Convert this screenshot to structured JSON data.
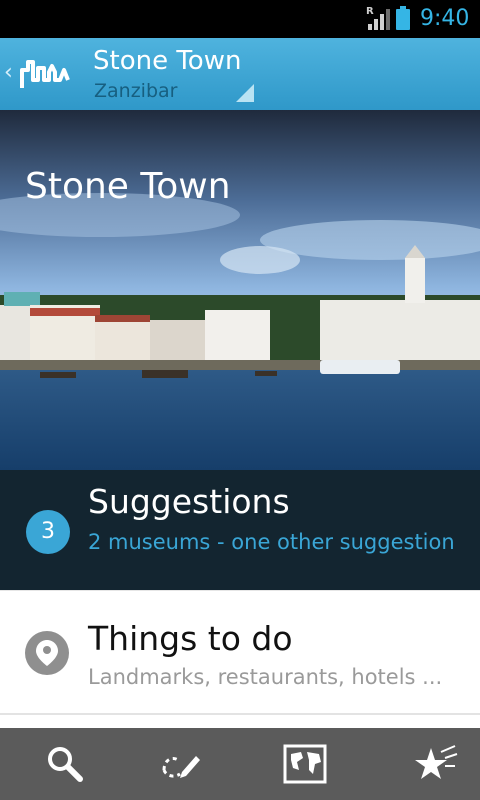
{
  "status_bar": {
    "time": "9:40",
    "roaming": "R"
  },
  "action_bar": {
    "title": "Stone Town",
    "subtitle": "Zanzibar",
    "up_caret": "‹"
  },
  "hero": {
    "title": "Stone Town"
  },
  "suggestions": {
    "count": "3",
    "title": "Suggestions",
    "subtitle": "2 museums - one other suggestion"
  },
  "things_to_do": {
    "title": "Things to do",
    "subtitle": "Landmarks, restaurants, hotels ..."
  },
  "bottom_bar": {
    "items": [
      {
        "icon": "search-icon"
      },
      {
        "icon": "edit-trip-icon"
      },
      {
        "icon": "world-map-icon"
      },
      {
        "icon": "favorites-icon"
      }
    ]
  },
  "colors": {
    "accent": "#3aa6d6",
    "action_bar": "#3aa6d6",
    "suggestions_bg": "#132530",
    "bottom_bar": "#5b5b5b"
  }
}
